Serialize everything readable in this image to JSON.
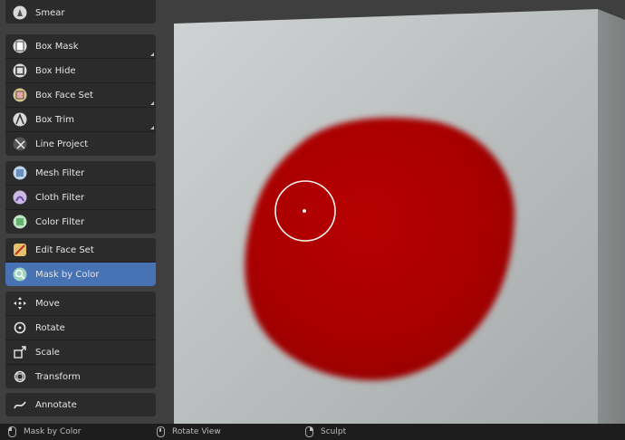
{
  "toolbar": {
    "groups": [
      [
        {
          "label": "Smear",
          "icon": "smear-brush-icon"
        }
      ],
      [
        {
          "label": "Box Mask",
          "icon": "box-mask-icon"
        },
        {
          "label": "Box Hide",
          "icon": "box-hide-icon"
        },
        {
          "label": "Box Face Set",
          "icon": "box-face-set-icon"
        },
        {
          "label": "Box Trim",
          "icon": "box-trim-icon"
        },
        {
          "label": "Line Project",
          "icon": "line-project-icon"
        }
      ],
      [
        {
          "label": "Mesh Filter",
          "icon": "mesh-filter-icon"
        },
        {
          "label": "Cloth Filter",
          "icon": "cloth-filter-icon"
        },
        {
          "label": "Color Filter",
          "icon": "color-filter-icon"
        }
      ],
      [
        {
          "label": "Edit Face Set",
          "icon": "edit-face-set-icon"
        },
        {
          "label": "Mask by Color",
          "icon": "mask-by-color-icon",
          "active": true
        }
      ],
      [
        {
          "label": "Move",
          "icon": "move-icon"
        },
        {
          "label": "Rotate",
          "icon": "rotate-icon"
        },
        {
          "label": "Scale",
          "icon": "scale-icon"
        },
        {
          "label": "Transform",
          "icon": "transform-icon"
        }
      ],
      [
        {
          "label": "Annotate",
          "icon": "annotate-icon"
        }
      ]
    ]
  },
  "statusbar": {
    "left_click": "Mask by Color",
    "middle_click": "Rotate View",
    "right_click": "Sculpt"
  },
  "colors": {
    "active_tool": "#4772b3",
    "paint": "#b00000",
    "cube_face": "#b8bcbc"
  }
}
